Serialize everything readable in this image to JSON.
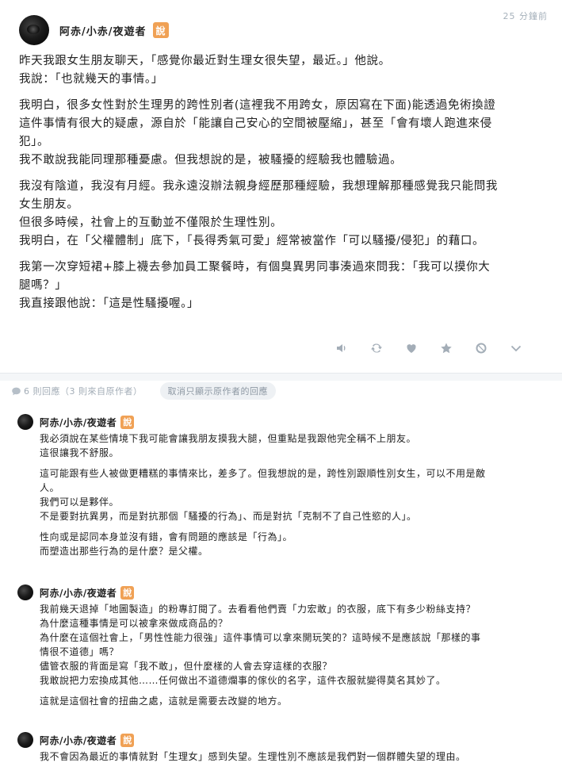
{
  "post": {
    "author": "阿赤/小赤/夜遊者",
    "badge": "說",
    "timestamp": "25 分鐘前",
    "paragraphs": [
      [
        "昨天我跟女生朋友聊天，「感覺你最近對生理女很失望，最近。」他說。",
        "我說：「也就幾天的事情。」"
      ],
      [
        "我明白，很多女性對於生理男的跨性別者(這裡我不用跨女，原因寫在下面)能透過免術換證",
        "這件事情有很大的疑慮，源自於「能讓自己安心的空間被壓縮」，甚至「會有壞人跑進來侵",
        "犯」。",
        "我不敢說我能同理那種憂慮。但我想說的是，被騷擾的經驗我也體驗過。"
      ],
      [
        "我沒有陰道，我沒有月經。我永遠沒辦法親身經歷那種經驗，我想理解那種感覺我只能問我",
        "女生朋友。",
        "但很多時候，社會上的互動並不僅限於生理性別。",
        "我明白，在「父權體制」底下，「長得秀氣可愛」經常被當作「可以騷擾/侵犯」的藉口。"
      ],
      [
        "我第一次穿短裙+膝上襪去參加員工聚餐時，有個臭異男同事湊過來問我：「我可以摸你大",
        "腿嗎？」",
        "我直接跟他說：「這是性騷擾喔。」"
      ]
    ],
    "actions": [
      "speaker-icon",
      "share-icon",
      "heart-icon",
      "star-icon",
      "block-icon",
      "chevron-down-icon"
    ]
  },
  "replies_bar": {
    "count_text": "6 則回應（3 則來自原作者）",
    "filter_label": "取消只顯示原作者的回應"
  },
  "replies": [
    {
      "author": "阿赤/小赤/夜遊者",
      "badge": "說",
      "paragraphs": [
        [
          "我必須說在某些情境下我可能會讓我朋友摸我大腿，但重點是我跟他完全稱不上朋友。",
          "這很讓我不舒服。"
        ],
        [
          "這可能跟有些人被做更糟糕的事情來比，差多了。但我想說的是，跨性別跟順性別女生，可以不用是敵",
          "人。",
          "我們可以是夥伴。",
          "不是要對抗異男，而是對抗那個「騷擾的行為」、而是對抗「克制不了自己性慾的人」。"
        ],
        [
          "性向或是認同本身並沒有錯，會有問題的應該是「行為」。",
          "而塑造出那些行為的是什麼？是父權。"
        ]
      ]
    },
    {
      "author": "阿赤/小赤/夜遊者",
      "badge": "說",
      "paragraphs": [
        [
          "我前幾天退掉「地圖製造」的粉專訂閱了。去看看他們賣「力宏敢」的衣服，底下有多少粉絲支持？",
          "為什麼這種事情是可以被拿來做成商品的？",
          "為什麼在這個社會上，「男性性能力很強」這件事情可以拿來開玩笑的？這時候不是應該說「那樣的事",
          "情很不道德」嗎？",
          "儘管衣服的背面是寫「我不敢」，但什麼樣的人會去穿這樣的衣服？",
          "我敢說把力宏換成其他……任何做出不道德爛事的傢伙的名字，這件衣服就變得莫名其妙了。"
        ],
        [
          "這就是這個社會的扭曲之處，這就是需要去改變的地方。"
        ]
      ]
    },
    {
      "author": "阿赤/小赤/夜遊者",
      "badge": "說",
      "paragraphs": [
        [
          "我不會因為最近的事情就對「生理女」感到失望。生理性別不應該是我們對一個群體失望的理由。"
        ]
      ]
    }
  ]
}
